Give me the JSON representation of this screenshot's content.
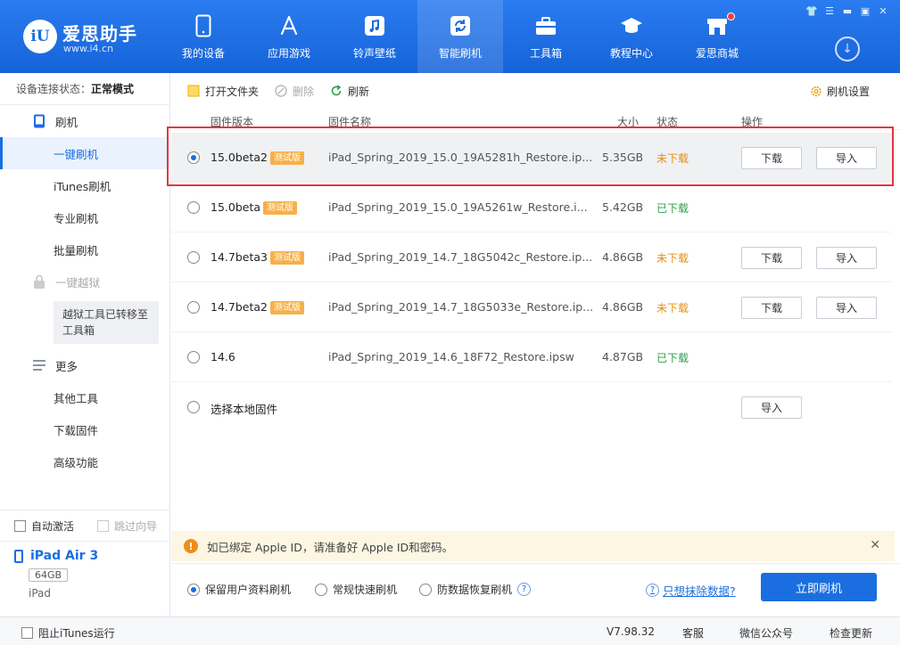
{
  "app": {
    "name": "爱思助手",
    "url": "www.i4.cn",
    "logo_text": "iU"
  },
  "window_controls": [
    "shirt-icon",
    "menu-icon",
    "minimize-icon",
    "maximize-icon",
    "close-icon"
  ],
  "nav": [
    {
      "label": "我的设备",
      "icon": "phone-icon"
    },
    {
      "label": "应用游戏",
      "icon": "app-store-icon"
    },
    {
      "label": "铃声壁纸",
      "icon": "music-icon"
    },
    {
      "label": "智能刷机",
      "icon": "refresh-icon",
      "active": true
    },
    {
      "label": "工具箱",
      "icon": "toolbox-icon"
    },
    {
      "label": "教程中心",
      "icon": "graduation-cap-icon"
    },
    {
      "label": "爱思商城",
      "icon": "store-icon"
    }
  ],
  "sidebar": {
    "status_label": "设备连接状态：",
    "status_value": "正常模式",
    "flash_group": "刷机",
    "flash_items": [
      "一键刷机",
      "iTunes刷机",
      "专业刷机",
      "批量刷机"
    ],
    "jailbreak_group": "一键越狱",
    "jailbreak_note": "越狱工具已转移至工具箱",
    "more_group": "更多",
    "more_items": [
      "其他工具",
      "下载固件",
      "高级功能"
    ],
    "auto_activate": "自动激活",
    "skip_guide": "跳过向导",
    "device_name": "iPad Air 3",
    "device_capacity": "64GB",
    "device_type": "iPad"
  },
  "toolbar": {
    "open_folder": "打开文件夹",
    "delete": "删除",
    "refresh": "刷新",
    "settings": "刷机设置"
  },
  "table": {
    "headers": {
      "version": "固件版本",
      "name": "固件名称",
      "size": "大小",
      "status": "状态",
      "action": "操作"
    },
    "beta_tag": "测试版",
    "download_btn": "下载",
    "import_btn": "导入",
    "rows": [
      {
        "version": "15.0beta2",
        "beta": true,
        "name": "iPad_Spring_2019_15.0_19A5281h_Restore.ip...",
        "size": "5.35GB",
        "status": "未下载",
        "downloaded": false,
        "selected": true
      },
      {
        "version": "15.0beta",
        "beta": true,
        "name": "iPad_Spring_2019_15.0_19A5261w_Restore.i...",
        "size": "5.42GB",
        "status": "已下载",
        "downloaded": true,
        "selected": false
      },
      {
        "version": "14.7beta3",
        "beta": true,
        "name": "iPad_Spring_2019_14.7_18G5042c_Restore.ip...",
        "size": "4.86GB",
        "status": "未下载",
        "downloaded": false,
        "selected": false
      },
      {
        "version": "14.7beta2",
        "beta": true,
        "name": "iPad_Spring_2019_14.7_18G5033e_Restore.ip...",
        "size": "4.86GB",
        "status": "未下载",
        "downloaded": false,
        "selected": false
      },
      {
        "version": "14.6",
        "beta": false,
        "name": "iPad_Spring_2019_14.6_18F72_Restore.ipsw",
        "size": "4.87GB",
        "status": "已下载",
        "downloaded": true,
        "selected": false
      }
    ],
    "local_firmware": "选择本地固件"
  },
  "notice": {
    "text": "如已绑定 Apple ID，请准备好 Apple ID和密码。"
  },
  "options": {
    "keep_data": "保留用户资料刷机",
    "quick": "常规快速刷机",
    "anti_recovery": "防数据恢复刷机",
    "erase_link": "只想抹除数据?",
    "flash_now": "立即刷机"
  },
  "footer": {
    "block_itunes": "阻止iTunes运行",
    "version": "V7.98.32",
    "service": "客服",
    "wechat": "微信公众号",
    "check_update": "检查更新"
  },
  "colors": {
    "accent": "#1a6ee0",
    "not_downloaded": "#e8900c",
    "downloaded": "#2aa14a",
    "highlight": "#e0383e"
  }
}
